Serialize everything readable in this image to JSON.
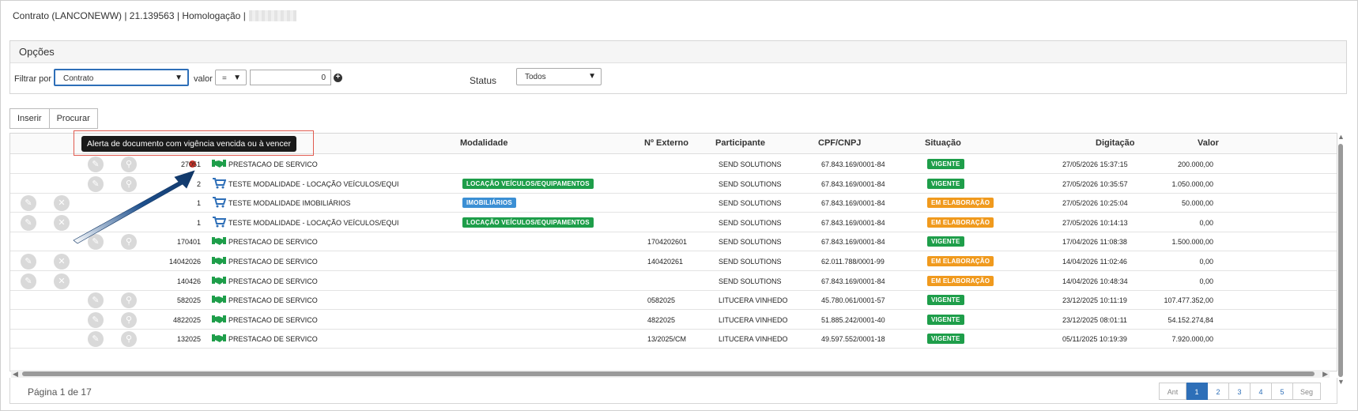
{
  "header": {
    "title": "Contrato (LANCONEWW) | 21.139563 | Homologação |"
  },
  "options": {
    "title": "Opções",
    "filter_label": "Filtrar por",
    "filter_value": "Contrato",
    "valor_label": "valor",
    "operator": "=",
    "number_value": "0",
    "status_label": "Status",
    "status_value": "Todos"
  },
  "toolbar": {
    "insert_label": "Inserir",
    "search_label": "Procurar"
  },
  "tooltip": {
    "text": "Alerta de documento com vigência vencida ou à vencer"
  },
  "columns": {
    "modalidade": "Modalidade",
    "externo": "Nº Externo",
    "participante": "Participante",
    "cpf": "CPF/CNPJ",
    "situacao": "Situação",
    "digitacao": "Digitação",
    "valor": "Valor"
  },
  "rows": [
    {
      "numero": "27051",
      "tipo": "PRESTACAO DE SERVICO",
      "modalidade": "",
      "externo": "",
      "participante": "SEND SOLUTIONS",
      "cpf": "67.843.169/0001-84",
      "situacao": "VIGENTE",
      "digitacao": "27/05/2026 15:37:15",
      "valor": "200.000,00"
    },
    {
      "numero": "2",
      "tipo": "TESTE MODALIDADE - LOCAÇÃO VEÍCULOS/EQUI",
      "modalidade": "LOCAÇÃO VEÍCULOS/EQUIPAMENTOS",
      "externo": "",
      "participante": "SEND SOLUTIONS",
      "cpf": "67.843.169/0001-84",
      "situacao": "VIGENTE",
      "digitacao": "27/05/2026 10:35:57",
      "valor": "1.050.000,00"
    },
    {
      "numero": "1",
      "tipo": "TESTE MODALIDADE IMOBILIÁRIOS",
      "modalidade": "IMOBILIÁRIOS",
      "externo": "",
      "participante": "SEND SOLUTIONS",
      "cpf": "67.843.169/0001-84",
      "situacao": "EM ELABORAÇÃO",
      "digitacao": "27/05/2026 10:25:04",
      "valor": "50.000,00"
    },
    {
      "numero": "1",
      "tipo": "TESTE MODALIDADE - LOCAÇÃO VEÍCULOS/EQUI",
      "modalidade": "LOCAÇÃO VEÍCULOS/EQUIPAMENTOS",
      "externo": "",
      "participante": "SEND SOLUTIONS",
      "cpf": "67.843.169/0001-84",
      "situacao": "EM ELABORAÇÃO",
      "digitacao": "27/05/2026 10:14:13",
      "valor": "0,00"
    },
    {
      "numero": "170401",
      "tipo": "PRESTACAO DE SERVICO",
      "modalidade": "",
      "externo": "1704202601",
      "participante": "SEND SOLUTIONS",
      "cpf": "67.843.169/0001-84",
      "situacao": "VIGENTE",
      "digitacao": "17/04/2026 11:08:38",
      "valor": "1.500.000,00"
    },
    {
      "numero": "14042026",
      "tipo": "PRESTACAO DE SERVICO",
      "modalidade": "",
      "externo": "140420261",
      "participante": "SEND SOLUTIONS",
      "cpf": "62.011.788/0001-99",
      "situacao": "EM ELABORAÇÃO",
      "digitacao": "14/04/2026 11:02:46",
      "valor": "0,00"
    },
    {
      "numero": "140426",
      "tipo": "PRESTACAO DE SERVICO",
      "modalidade": "",
      "externo": "",
      "participante": "SEND SOLUTIONS",
      "cpf": "67.843.169/0001-84",
      "situacao": "EM ELABORAÇÃO",
      "digitacao": "14/04/2026 10:48:34",
      "valor": "0,00"
    },
    {
      "numero": "582025",
      "tipo": "PRESTACAO DE SERVICO",
      "modalidade": "",
      "externo": "0582025",
      "participante": "LITUCERA VINHEDO",
      "cpf": "45.780.061/0001-57",
      "situacao": "VIGENTE",
      "digitacao": "23/12/2025 10:11:19",
      "valor": "107.477.352,00"
    },
    {
      "numero": "4822025",
      "tipo": "PRESTACAO DE SERVICO",
      "modalidade": "",
      "externo": "4822025",
      "participante": "LITUCERA VINHEDO",
      "cpf": "51.885.242/0001-40",
      "situacao": "VIGENTE",
      "digitacao": "23/12/2025 08:01:11",
      "valor": "54.152.274,84"
    },
    {
      "numero": "132025",
      "tipo": "PRESTACAO DE SERVICO",
      "modalidade": "",
      "externo": "13/2025/CM",
      "participante": "LITUCERA VINHEDO",
      "cpf": "49.597.552/0001-18",
      "situacao": "VIGENTE",
      "digitacao": "05/11/2025 10:19:39",
      "valor": "7.920.000,00"
    }
  ],
  "pagination": {
    "info": "Página 1 de 17",
    "prev": "Ant",
    "pages": [
      "1",
      "2",
      "3",
      "4",
      "5"
    ],
    "next": "Seg"
  },
  "colors": {
    "vigente": "#1e9e4a",
    "em_elaboracao": "#f09a1e",
    "modalidade_green": "#1e9e4a",
    "modalidade_blue": "#3b8fd4",
    "alert_dot": "#d9352a",
    "accent": "#2e6fb8"
  }
}
